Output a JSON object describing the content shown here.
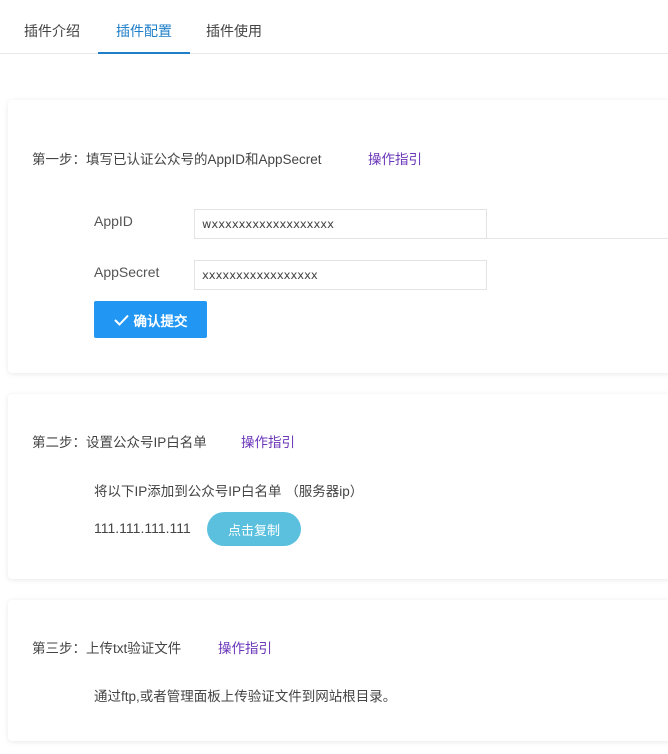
{
  "tabs": [
    {
      "label": "插件介绍",
      "active": false
    },
    {
      "label": "插件配置",
      "active": true
    },
    {
      "label": "插件使用",
      "active": false
    }
  ],
  "step1": {
    "prefix": "第一步：",
    "title": "填写已认证公众号的AppID和AppSecret",
    "guide_link": "操作指引",
    "appid_label": "AppID",
    "appid_value": "wxxxxxxxxxxxxxxxxxx",
    "appsecret_label": "AppSecret",
    "appsecret_value": "xxxxxxxxxxxxxxxxx",
    "confirm_button": "确认提交"
  },
  "step2": {
    "prefix": "第二步：",
    "title": "设置公众号IP白名单",
    "guide_link": "操作指引",
    "instruction": "将以下IP添加到公众号IP白名单 （服务器ip）",
    "ip_address": "111.111.111.111",
    "copy_button": "点击复制"
  },
  "step3": {
    "prefix": "第三步：",
    "title": "上传txt验证文件",
    "guide_link": "操作指引",
    "instruction": "通过ftp,或者管理面板上传验证文件到网站根目录。"
  },
  "colors": {
    "tab_active": "#1e7ec8",
    "link": "#6a35b8",
    "primary_button": "#2196f3",
    "copy_button": "#5bc0de"
  },
  "icons": {
    "confirm_icon": "check-icon"
  }
}
